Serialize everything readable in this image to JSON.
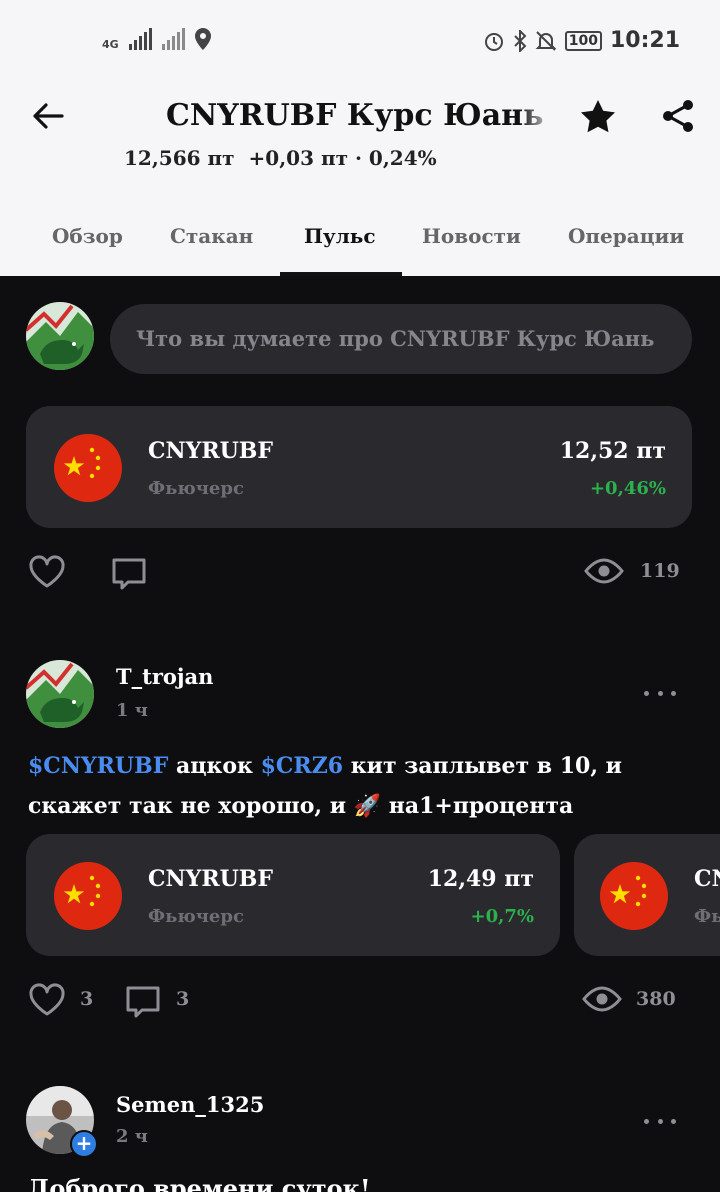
{
  "status_bar": {
    "network": "4G",
    "battery": "100",
    "time": "10:21"
  },
  "header": {
    "title": "CNYRUBF Курс Юань",
    "price": "12,566 пт",
    "change": "+0,03 пт · 0,24%"
  },
  "tabs": [
    {
      "label": "Обзор"
    },
    {
      "label": "Стакан"
    },
    {
      "label": "Пульс"
    },
    {
      "label": "Новости"
    },
    {
      "label": "Операции"
    }
  ],
  "active_tab": "Пульс",
  "composer": {
    "placeholder": "Что вы думаете про CNYRUBF Курс Юань"
  },
  "first_post": {
    "instrument": {
      "ticker": "CNYRUBF",
      "type": "Фьючерс",
      "price": "12,52 пт",
      "change": "+0,46%"
    },
    "views": "119"
  },
  "second_post": {
    "author": "T_trojan",
    "time": "1 ч",
    "text": {
      "tag1": "$CNYRUBF",
      "part1": " ацкок ",
      "tag2": "$CRZ6",
      "part2": "  кит заплывет в 10, и скажет так не хорошо, и ",
      "emoji": "🚀",
      "part3": " на1+процента"
    },
    "instrument": {
      "ticker": "CNYRUBF",
      "type": "Фьючерс",
      "price": "12,49 пт",
      "change": "+0,7%"
    },
    "instrument2": {
      "ticker": "CNYRUBF",
      "type": "Фьючерс"
    },
    "likes": "3",
    "comments": "3",
    "views": "380"
  },
  "third_post": {
    "author": "Semen_1325",
    "time": "2 ч",
    "text": "Доброго времени суток!"
  },
  "colors": {
    "accent_green": "#2bb24c",
    "tag_blue": "#4a8df0",
    "flag_red": "#de2910",
    "flag_yellow": "#ffde00"
  }
}
